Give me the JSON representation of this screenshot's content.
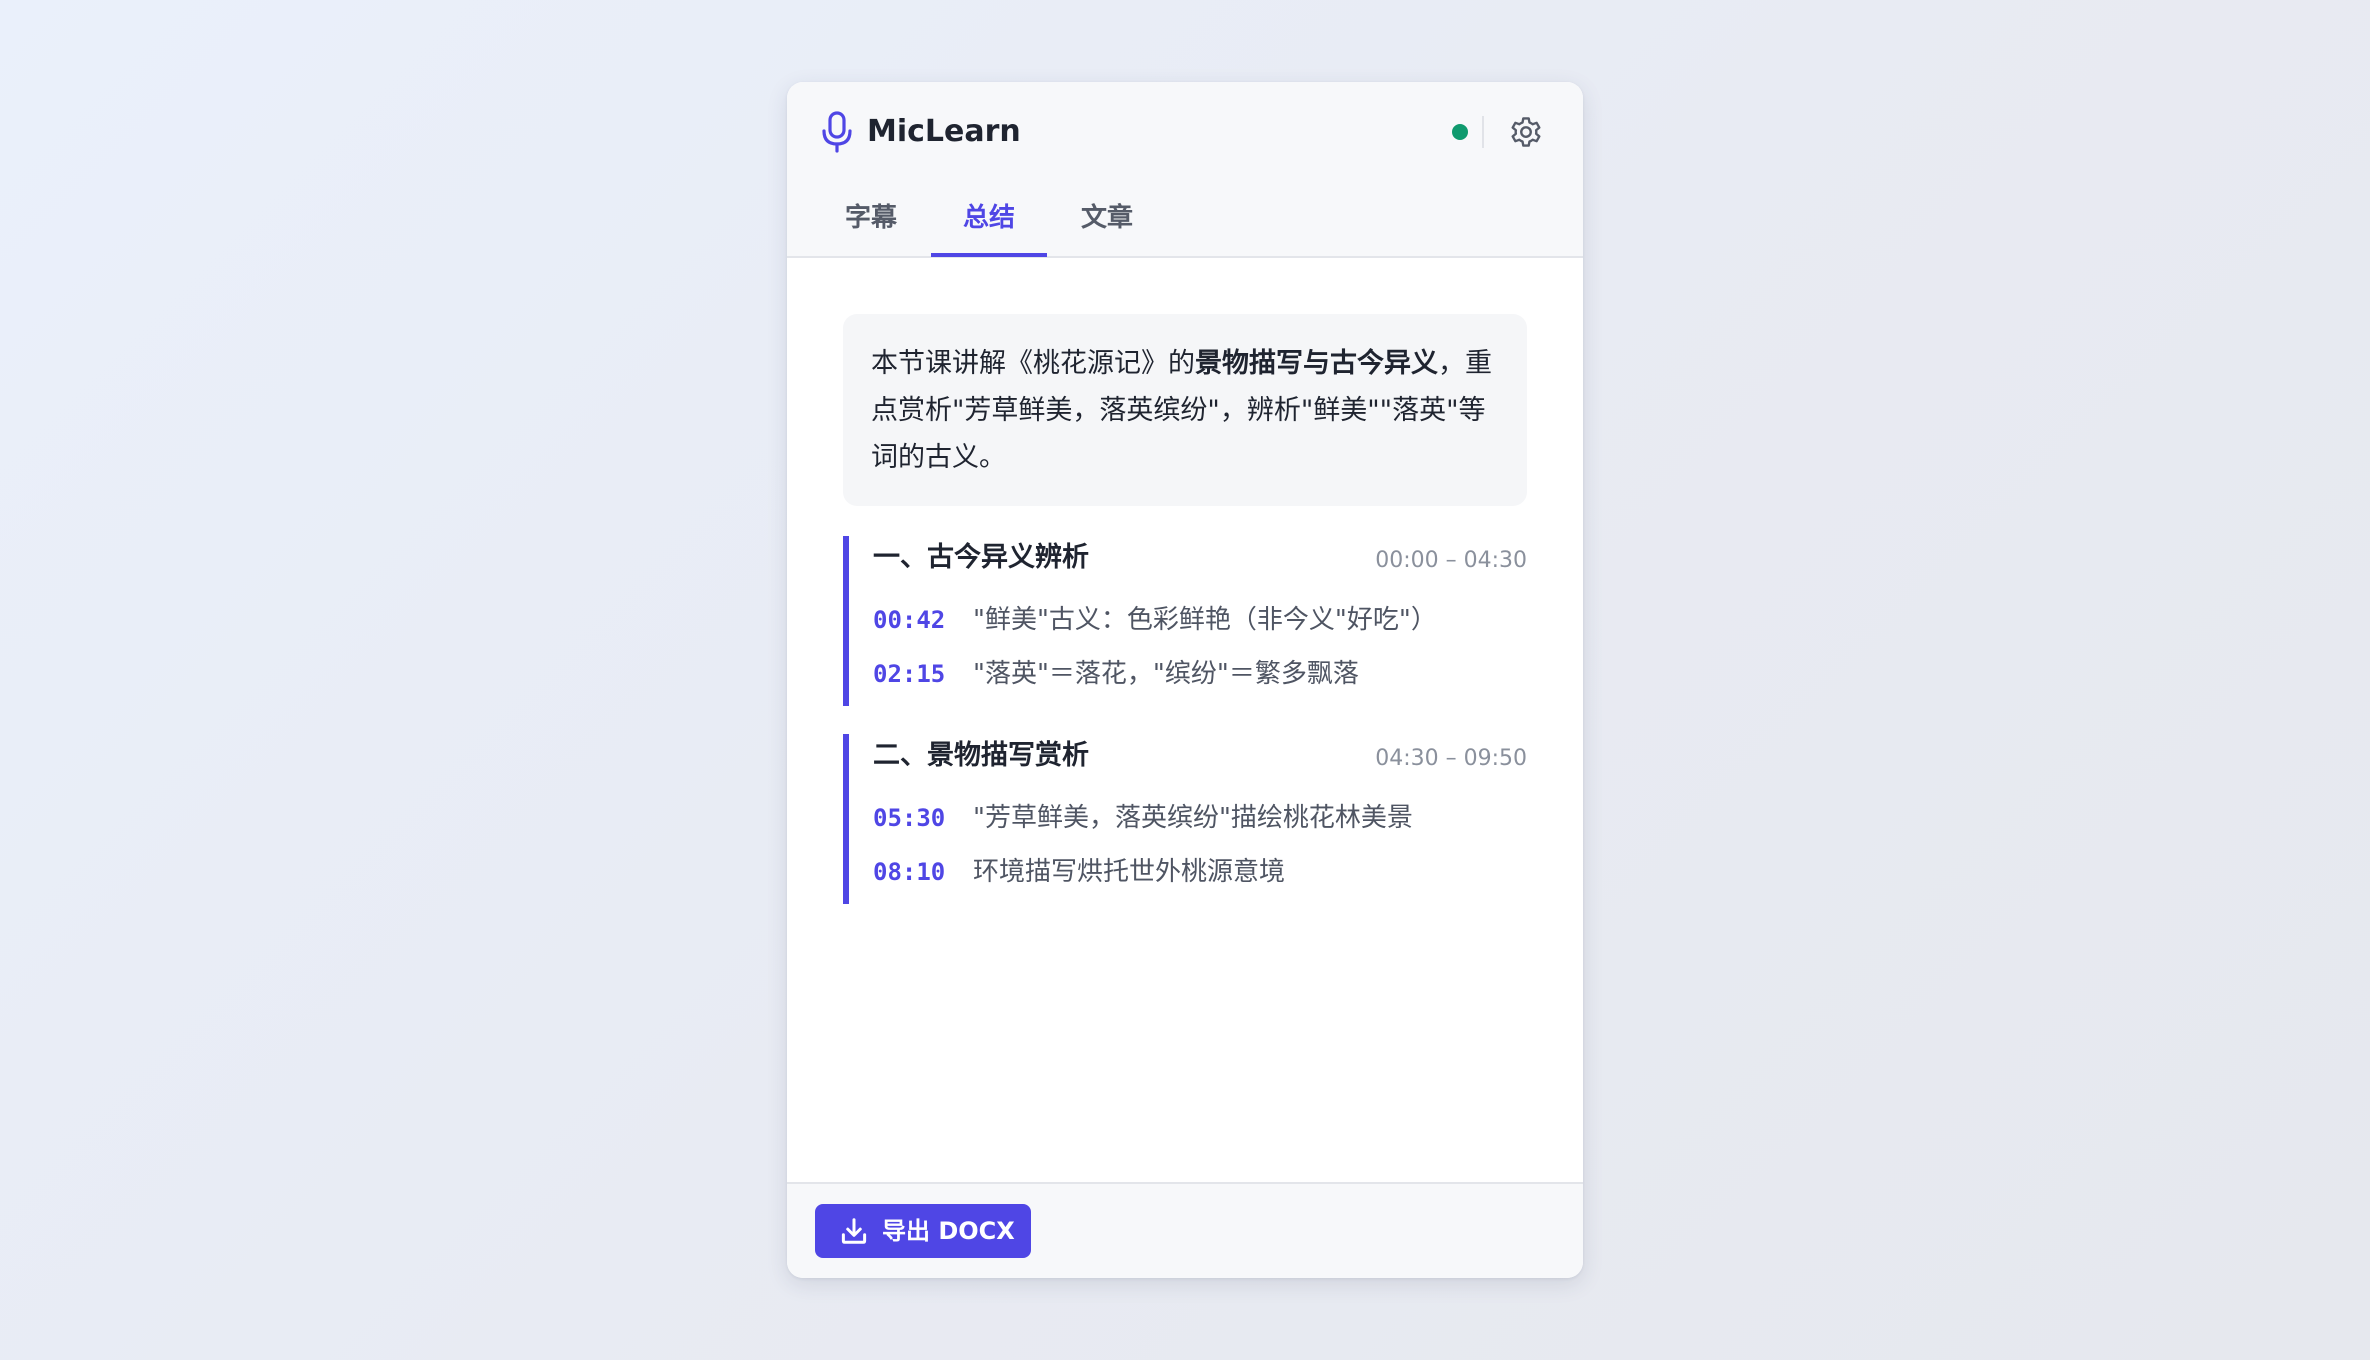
{
  "app": {
    "title": "MicLearn",
    "status_color": "#0f9a6e",
    "accent_color": "#4f46e5",
    "icons": [
      "microphone-icon",
      "gear-icon",
      "download-icon"
    ]
  },
  "tabs": [
    {
      "label": "字幕",
      "active": false
    },
    {
      "label": "总结",
      "active": true
    },
    {
      "label": "文章",
      "active": false
    }
  ],
  "summary": {
    "text_before": "本节课讲解《桃花源记》的",
    "text_bold": "景物描写与古今异义",
    "text_after": "，重点赏析\"芳草鲜美，落英缤纷\"，辨析\"鲜美\"\"落英\"等词的古义。"
  },
  "sections": [
    {
      "title": "一、古今异义辨析",
      "range": "00:00 – 04:30",
      "items": [
        {
          "time": "00:42",
          "text": "\"鲜美\"古义：色彩鲜艳（非今义\"好吃\"）"
        },
        {
          "time": "02:15",
          "text": "\"落英\"＝落花，\"缤纷\"＝繁多飘落"
        }
      ]
    },
    {
      "title": "二、景物描写赏析",
      "range": "04:30 – 09:50",
      "items": [
        {
          "time": "05:30",
          "text": "\"芳草鲜美，落英缤纷\"描绘桃花林美景"
        },
        {
          "time": "08:10",
          "text": "环境描写烘托世外桃源意境"
        }
      ]
    }
  ],
  "footer": {
    "export_label": "导出 DOCX"
  }
}
